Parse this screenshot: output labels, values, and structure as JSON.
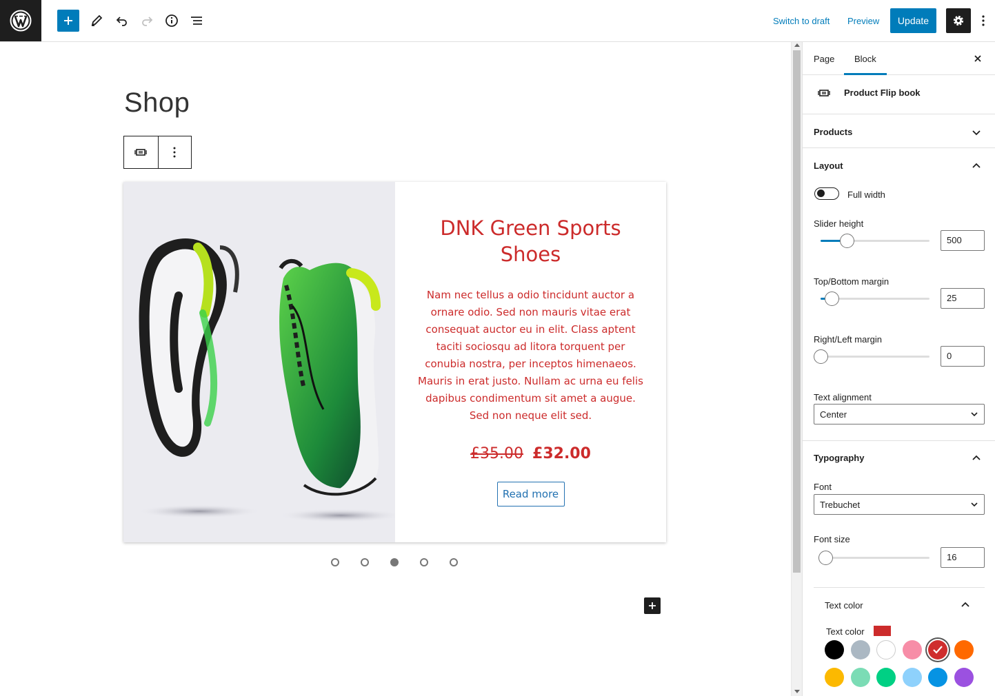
{
  "topbar": {
    "switch_to_draft": "Switch to draft",
    "preview": "Preview",
    "update": "Update"
  },
  "editor": {
    "page_title": "Shop"
  },
  "product": {
    "title": "DNK Green Sports Shoes",
    "description": "Nam nec tellus a odio tincidunt auctor a ornare odio. Sed non mauris vitae erat consequat auctor eu in elit. Class aptent taciti sociosqu ad litora torquent per conubia nostra, per inceptos himenaeos. Mauris in erat justo. Nullam ac urna eu felis dapibus condimentum sit amet a augue. Sed non neque elit sed.",
    "price_old": "£35.00",
    "price_new": "£32.00",
    "read_more": "Read more",
    "text_color": "#cc2b2b"
  },
  "slider_dots": {
    "count": 5,
    "active_index": 2
  },
  "sidebar": {
    "tab_page": "Page",
    "tab_block": "Block",
    "block_name": "Product Flip book",
    "products_label": "Products",
    "layout_label": "Layout",
    "full_width_label": "Full width",
    "slider_height_label": "Slider height",
    "slider_height_value": "500",
    "top_bottom_margin_label": "Top/Bottom margin",
    "top_bottom_margin_value": "25",
    "right_left_margin_label": "Right/Left margin",
    "right_left_margin_value": "0",
    "text_alignment_label": "Text alignment",
    "text_alignment_value": "Center",
    "typography_label": "Typography",
    "font_label": "Font",
    "font_value": "Trebuchet",
    "font_size_label": "Font size",
    "font_size_value": "16",
    "text_color_panel_label": "Text color",
    "text_color_label": "Text color",
    "palette": [
      "#000000",
      "#abb8c3",
      "#ffffff",
      "#f78da7",
      "#cf2e2e",
      "#ff6900",
      "#fcb900",
      "#7bdcb5",
      "#00d084",
      "#8ed1fc",
      "#0693e3",
      "#9b51e0"
    ],
    "selected_color_index": 4
  }
}
